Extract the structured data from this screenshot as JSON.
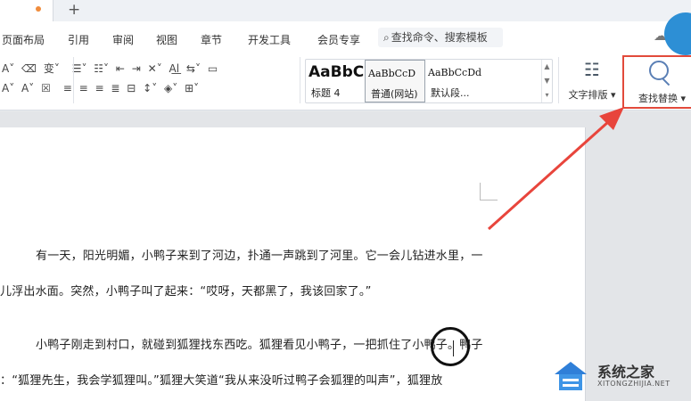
{
  "tabs": {
    "new_tab": "+"
  },
  "menu": {
    "items": [
      "页面布局",
      "引用",
      "审阅",
      "视图",
      "章节",
      "开发工具",
      "会员专享"
    ],
    "search_label": "查找命令、搜索模板",
    "search_icon": "magnifier-icon"
  },
  "ribbon": {
    "font_row1": [
      "A˅",
      "⌫",
      "变˅",
      "☰˅",
      "☷˅",
      "⇤",
      "⇥",
      "✕˅",
      "A͟l",
      "⇆˅",
      "▭"
    ],
    "font_row2": [
      "A˅",
      "A˅",
      "☒",
      "≡",
      "≡",
      "≡",
      "≣",
      "⊟",
      "↕˅",
      "◈˅",
      "⊞˅"
    ],
    "styles": [
      {
        "sample": "AaBbC",
        "caption": "标题 4"
      },
      {
        "sample": "AaBbCcD",
        "caption": "普通(网站)"
      },
      {
        "sample": "AaBbCcDd",
        "caption": "默认段..."
      }
    ],
    "text_layout_label": "文字排版",
    "find_replace_label": "查找替换",
    "find_replace_highlight_color": "#e24a3b"
  },
  "document": {
    "lines": [
      "有一天，阳光明媚，小鸭子来到了河边，扑通一声跳到了河里。它一会儿钻进水里，一",
      "儿浮出水面。突然，小鸭子叫了起来：“哎呀，天都黑了，我该回家了。”",
      "小鸭子刚走到村口，就碰到狐狸找东西吃。狐狸看见小鸭子，一把抓住了小鸭子。鸭子",
      "：“狐狸先生，我会学狐狸叫。”狐狸大笑道“我从来没听过鸭子会狐狸的叫声”，狐狸放"
    ]
  },
  "watermark": {
    "title": "系统之家",
    "subtitle": "XITONGZHIJIA.NET"
  },
  "annotation": {
    "arrow_color": "#e8453c"
  }
}
